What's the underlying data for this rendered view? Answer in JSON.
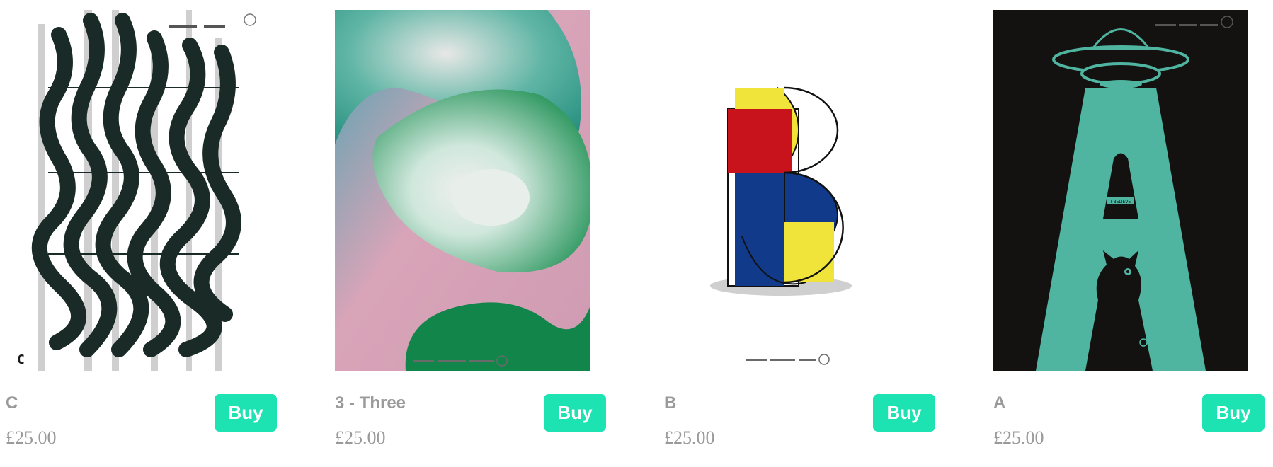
{
  "products": [
    {
      "title": "C",
      "price": "£25.00",
      "buy_label": "Buy",
      "poster_letter": "C"
    },
    {
      "title": "3 - Three",
      "price": "£25.00",
      "buy_label": "Buy"
    },
    {
      "title": "B",
      "price": "£25.00",
      "buy_label": "Buy"
    },
    {
      "title": "A",
      "price": "£25.00",
      "buy_label": "Buy",
      "poster_label": "I BELIEVE"
    }
  ],
  "colors": {
    "buy_button": "#1de3b3",
    "text_muted": "#9a9a9a",
    "accent_green": "#4fb4a0",
    "poster_dark": "#141210"
  }
}
